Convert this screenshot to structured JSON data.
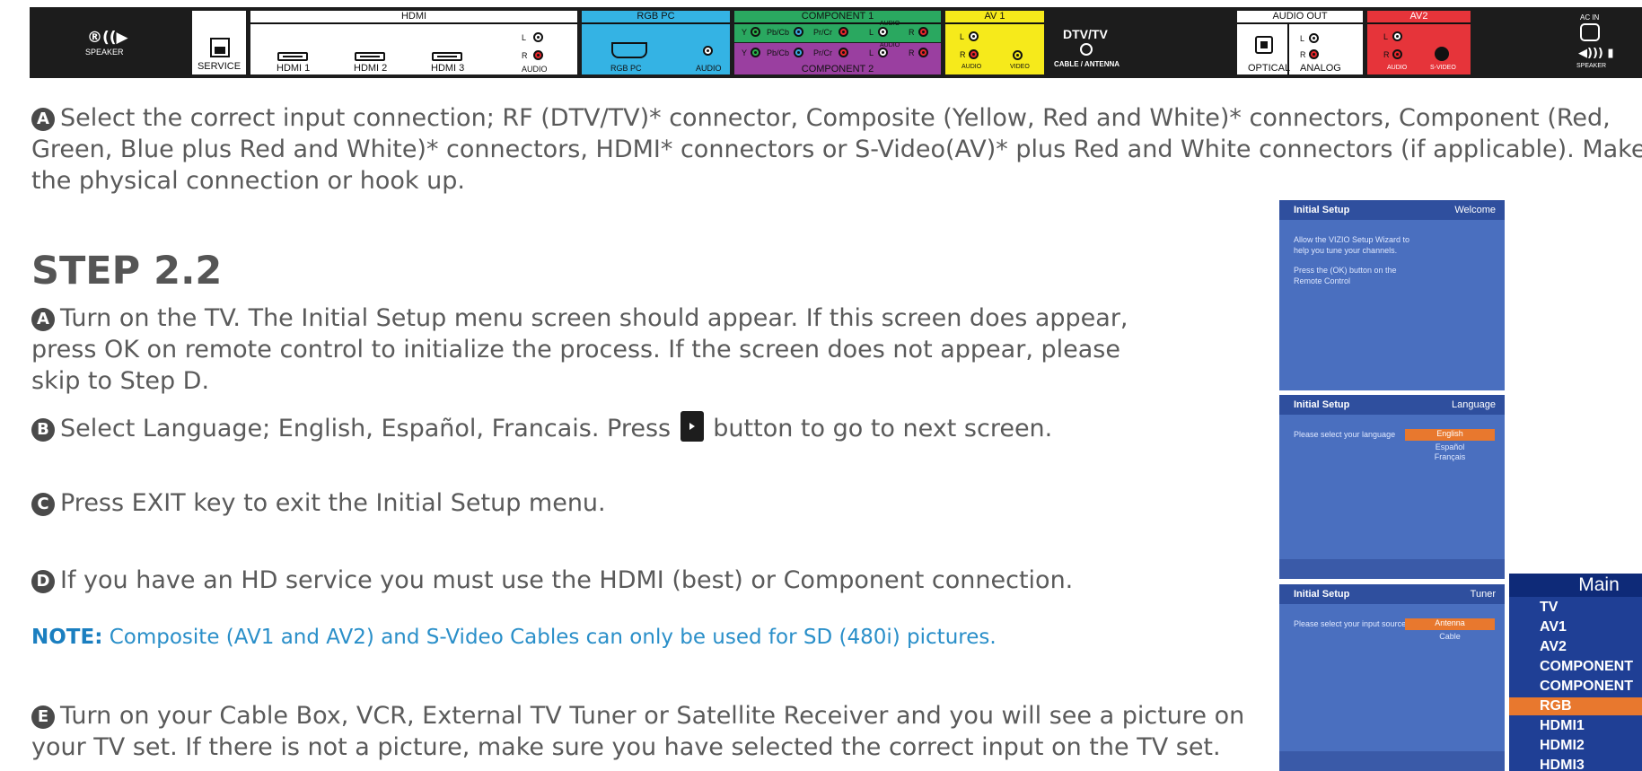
{
  "panel": {
    "speaker_left": "SPEAKER",
    "service": "SERVICE",
    "hdmi_header": "HDMI",
    "hdmi_ports": [
      "HDMI 1",
      "HDMI 2",
      "HDMI 3"
    ],
    "hdmi_audio": "AUDIO",
    "l": "L",
    "r": "R",
    "rgbpc_header": "RGB  PC",
    "rgbpc": "RGB PC",
    "rgbpc_audio": "AUDIO",
    "comp1": "COMPONENT  1",
    "comp2": "COMPONENT  2",
    "y": "Y",
    "pbcb": "Pb/Cb",
    "prcr": "Pr/Cr",
    "comp_audio": "AUDIO",
    "av1": "AV 1",
    "av1_audio": "AUDIO",
    "av1_video": "VIDEO",
    "dtv": "DTV/TV",
    "cable": "CABLE / ANTENNA",
    "audio_out": "AUDIO OUT",
    "optical": "OPTICAL",
    "analog": "ANALOG",
    "av2": "AV2",
    "av2_audio": "AUDIO",
    "svideo": "S-VIDEO",
    "acin": "AC IN",
    "speaker_right": "SPEAKER"
  },
  "intro": {
    "letter": "A",
    "text": "Select the correct input connection; RF (DTV/TV)* connector, Composite (Yellow, Red and White)* connectors, Component (Red, Green, Blue plus Red and White)* connectors, HDMI* connectors or S-Video(AV)* plus Red and White connectors (if applicable). Make the physical connection or hook up."
  },
  "step": {
    "title": "STEP 2.2",
    "a_letter": "A",
    "a_text": "Turn on the TV. The Initial Setup menu screen should appear. If this screen does appear, press OK on remote control to initialize the process. If the screen does not appear, please skip to Step D.",
    "b_letter": "B",
    "b_text_1": "Select Language; English, Español, Francais. Press",
    "b_text_2": "button to go to next screen.",
    "c_letter": "C",
    "c_text": "Press EXIT key to exit the Initial Setup menu.",
    "d_letter": "D",
    "d_text": "If you have an HD service you must use the HDMI (best) or Component connection.",
    "note_label": "NOTE:",
    "note_text": "Composite (AV1 and AV2) and S-Video Cables can only be used for SD (480i) pictures.",
    "e_letter": "E",
    "e_text": "Turn on your Cable Box, VCR, External TV Tuner or Satellite Receiver and you will see a picture on your TV set. If there is not a picture, make sure you have selected the correct input on the TV set."
  },
  "screens": {
    "s1_title": "Initial Setup",
    "s1_tag": "Welcome",
    "s1_line1": "Allow the VIZIO Setup Wizard to help you tune your channels.",
    "s1_line2": "Press the (OK) button on the Remote Control",
    "s2_title": "Initial Setup",
    "s2_tag": "Language",
    "s2_prompt": "Please select your language",
    "s2_opts": [
      "English",
      "Español",
      "Français"
    ],
    "s3_title": "Initial Setup",
    "s3_tag": "Tuner",
    "s3_prompt": "Please select your input source",
    "s3_opts": [
      "Antenna",
      "Cable"
    ]
  },
  "menu": {
    "title": "Main",
    "items": [
      "TV",
      "AV1",
      "AV2",
      "COMPONENT",
      "COMPONENT",
      "RGB",
      "HDMI1",
      "HDMI2",
      "HDMI3"
    ],
    "selected": 5
  }
}
